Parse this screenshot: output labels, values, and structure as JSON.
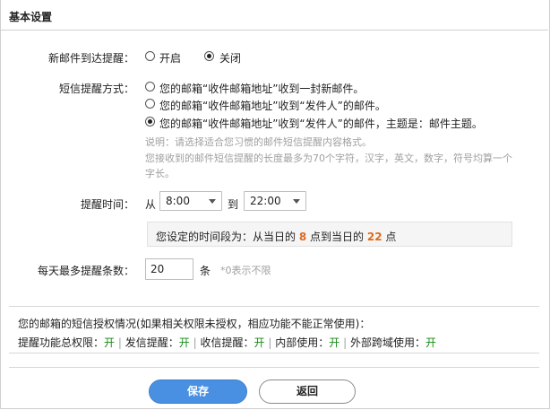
{
  "header": {
    "title": "基本设置"
  },
  "new_mail_alert": {
    "label": "新邮件到达提醒：",
    "options": [
      "开启",
      "关闭"
    ],
    "selected_index": 1
  },
  "sms_mode": {
    "label": "短信提醒方式：",
    "options": [
      "您的邮箱“收件邮箱地址”收到一封新邮件。",
      "您的邮箱“收件邮箱地址”收到“发件人”的邮件。",
      "您的邮箱“收件邮箱地址”收到“发件人”的邮件，主题是：邮件主题。"
    ],
    "selected_index": 2,
    "note_line1": "说明：请选择适合您习惯的邮件短信提醒内容格式。",
    "note_line2": "您接收到的邮件短信提醒的长度最多为70个字符，汉字，英文，数字，符号均算一个",
    "note_line3": "字长。"
  },
  "reminder_time": {
    "label": "提醒时间：",
    "from_label": "从",
    "from_value": "8:00",
    "to_label": "到",
    "to_value": "22:00",
    "summary_prefix": "您设定的时间段为：从当日的",
    "summary_from": "8",
    "summary_mid": "点到当日的",
    "summary_to": "22",
    "summary_suffix": "点"
  },
  "daily_limit": {
    "label": "每天最多提醒条数：",
    "value": "20",
    "unit": "条",
    "hint": "*0表示不限"
  },
  "authorization": {
    "title": "您的邮箱的短信授权情况(如果相关权限未授权，相应功能不能正常使用)：",
    "items": [
      {
        "label": "提醒功能总权限：",
        "value": "开"
      },
      {
        "label": "发信提醒：",
        "value": "开"
      },
      {
        "label": "收信提醒：",
        "value": "开"
      },
      {
        "label": "内部使用：",
        "value": "开"
      },
      {
        "label": "外部跨域使用：",
        "value": "开"
      }
    ],
    "separator": "|"
  },
  "actions": {
    "save": "保存",
    "back": "返回"
  },
  "colors": {
    "accent_blue": "#4a90e2",
    "highlight_orange": "#e06a1b",
    "enabled_green": "#1a8b1a"
  }
}
